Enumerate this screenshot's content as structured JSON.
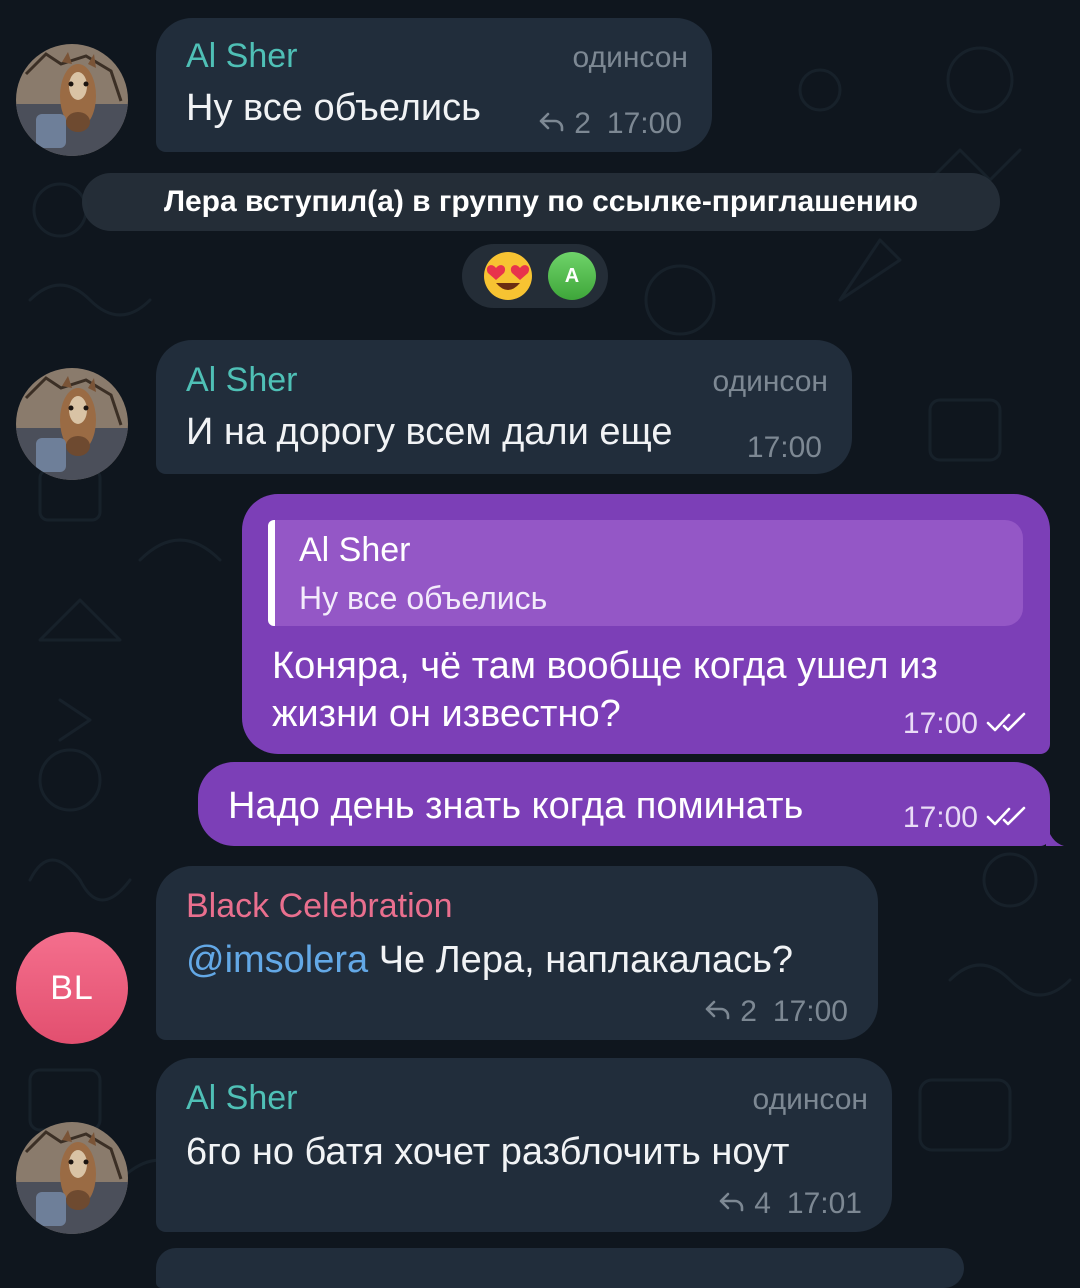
{
  "colors": {
    "background": "#0f161e",
    "incoming_bubble": "#212d3b",
    "outgoing_bubble": "#7c3fb7",
    "reply_box": "#9457c6",
    "sender_teal": "#4fc0b6",
    "sender_pink": "#e96f8e",
    "mention": "#63a8e6",
    "meta_gray": "#7d8893"
  },
  "service_message": "Лера вступил(а) в группу по ссылке-приглашению",
  "reaction": {
    "emoji": "😍",
    "avatar_letter": "A"
  },
  "messages": [
    {
      "sender": "Al Sher",
      "rank": "одинсон",
      "text": "Ну все объелись",
      "replies": "2",
      "time": "17:00"
    },
    {
      "sender": "Al Sher",
      "rank": "одинсон",
      "text": "И на дорогу всем дали еще",
      "time": "17:00"
    },
    {
      "reply_to_sender": "Al Sher",
      "reply_to_text": "Ну все объелись",
      "text_line1": "Коняра, чё там вообще когда ушел из",
      "text_line2": "жизни он известно?",
      "time": "17:00"
    },
    {
      "text": "Надо день знать когда поминать",
      "time": "17:00"
    },
    {
      "sender": "Black Celebration",
      "avatar_initials": "BL",
      "mention": "@imsolera",
      "text": " Че Лера, наплакалась?",
      "replies": "2",
      "time": "17:00"
    },
    {
      "sender": "Al Sher",
      "rank": "одинсон",
      "text": "6го но батя хочет разблочить ноут",
      "replies": "4",
      "time": "17:01"
    }
  ]
}
